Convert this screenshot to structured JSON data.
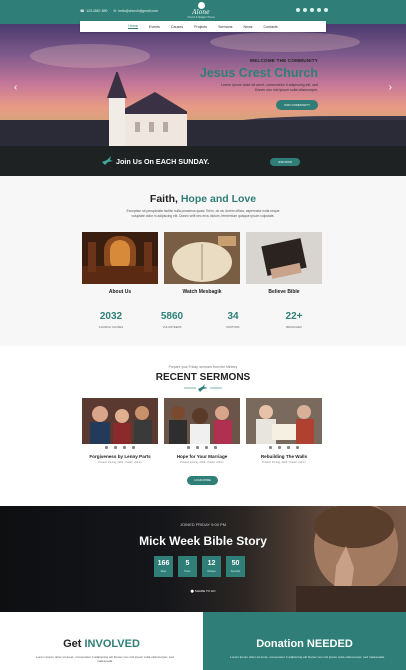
{
  "topbar": {
    "phone": "123-4567-890",
    "email": "hello@church@gmail.com",
    "social_icons": [
      "facebook-icon",
      "twitter-icon",
      "google-plus-icon",
      "pinterest-icon",
      "instagram-icon"
    ]
  },
  "logo": {
    "name": "Alone",
    "tagline": "Church & Religion Theme"
  },
  "nav": [
    "Home",
    "Events",
    "Causes",
    "Projects",
    "Sermons",
    "News",
    "Contacts"
  ],
  "hero": {
    "kicker": "WELCOME THE COMMUNITY",
    "title": "Jesus Crest Church",
    "desc": "Lorem ipsum dolor sit amet, consectetur it adipiscing elit, sed Donec nec nisl ipsum sulla ullamcorper.",
    "button": "JOIN COMMUNITY"
  },
  "sunday": {
    "text": "Join Us On EACH SUNDAY.",
    "button": "JOIN NOW"
  },
  "faith": {
    "title_start": "Faith, ",
    "title_hl": "Hope and Love",
    "desc": "Excepteur sit perspiciatis facilisi nulla possimus quasi. Enim, do sic dorem officia, aspernatur nulla neque voluptate dolor in adipiscing elit. Donec velit nec eros dictum, fermentum quisque ipsum vulputate.",
    "cards": [
      "About Us",
      "Watch Mesbagik",
      "Believe Bible"
    ],
    "stats": [
      {
        "num": "2032",
        "label": "CHURCH CAUSES"
      },
      {
        "num": "5860",
        "label": "VOLUNTEERS"
      },
      {
        "num": "34",
        "label": "PASTORS"
      },
      {
        "num": "22+",
        "label": "BRANCHES"
      }
    ]
  },
  "sermons": {
    "kicker": "Prepare your Friday, sermons from the Ministry",
    "title": "RECENT SERMONS",
    "items": [
      {
        "title": "Forgiveness by Lenny Parts",
        "meta": "Posted: 24 Aug, 2019 · Pastor: Admin"
      },
      {
        "title": "Hope for Your Marriage",
        "meta": "Posted: 24 Aug, 2019 · Pastor: Admin"
      },
      {
        "title": "Rebuilding The Walls",
        "meta": "Posted: 24 Aug, 2019 · Pastor: Admin"
      }
    ],
    "button": "LOAD MORE"
  },
  "event": {
    "kicker": "JOINED FRIDAY 9:00 PM",
    "title": "Mick Week Bible Story",
    "counter": [
      {
        "v": "166",
        "u": "Days"
      },
      {
        "v": "5",
        "u": "Hours"
      },
      {
        "v": "12",
        "u": "Minutes"
      },
      {
        "v": "50",
        "u": "Seconds"
      }
    ],
    "share": "SHARE TO GO"
  },
  "involved": {
    "title_start": "Get ",
    "title_hl": "INVOLVED",
    "desc": "Lorem ipsum dolor sit amet, consectetur it adipiscing elit Donec nec nisl ipsum sulla ullamcorper, sed malesuada."
  },
  "donation": {
    "title": "Donation NEEDED",
    "desc": "Lorem ipsum dolor sit amet, consectetur it adipiscing elit Donec nec nisl ipsum sulla ullamcorper, sed malesuada."
  },
  "colors": {
    "accent": "#2f7f78",
    "dark": "#1e2222"
  }
}
